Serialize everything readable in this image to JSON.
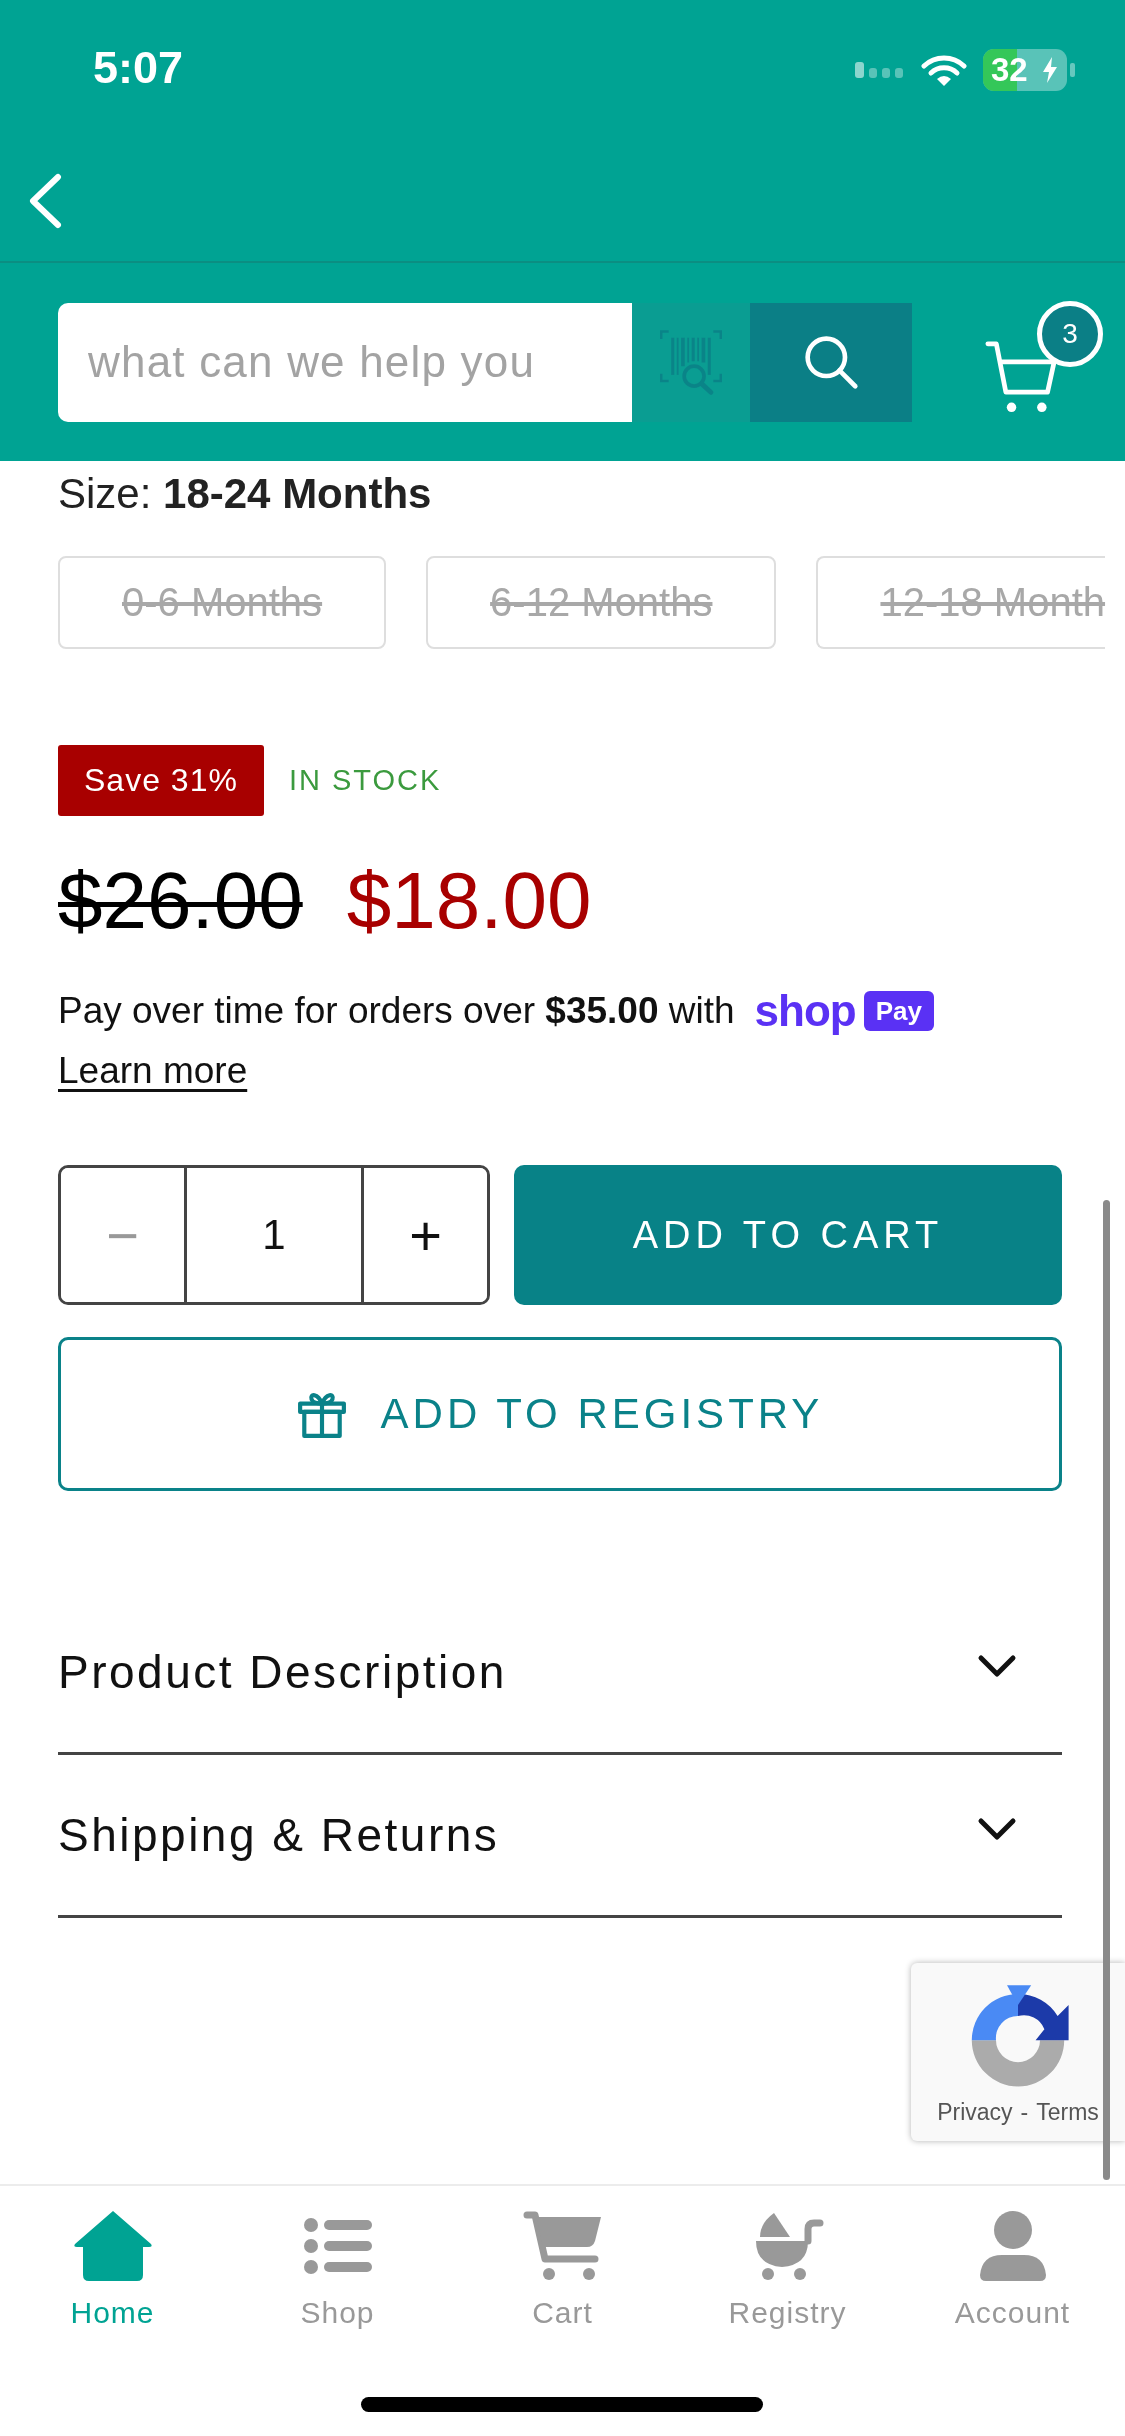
{
  "status_bar": {
    "time": "5:07",
    "battery": "32"
  },
  "search": {
    "placeholder": "what can we help you",
    "cart_count": "3"
  },
  "size": {
    "label": "Size:",
    "value": "18-24 Months",
    "options": [
      {
        "label": "0-6 Months",
        "selected": false,
        "available": false
      },
      {
        "label": "6-12 Months",
        "selected": false,
        "available": false
      },
      {
        "label": "12-18 Month",
        "selected": false,
        "available": false
      }
    ]
  },
  "badges": {
    "save": "Save 31%",
    "stock": "IN STOCK"
  },
  "price": {
    "compare_at": "$26.00",
    "current": "$18.00"
  },
  "installments": {
    "text": "Pay over time for orders over **$35.00** with",
    "brand": "shop",
    "brand_badge": "Pay",
    "link": "Learn more"
  },
  "quantity": {
    "decrease": {
      "label": "−",
      "disabled": true
    },
    "value": "1",
    "increase": {
      "label": "+",
      "disabled": false
    }
  },
  "add_to_cart": "ADD TO CART",
  "add_to_registry": "ADD TO REGISTRY",
  "accordions": [
    {
      "title": "Product Description",
      "expanded": false
    },
    {
      "title": "Shipping & Returns",
      "expanded": false
    }
  ],
  "recaptcha": {
    "privacy": "Privacy",
    "separator": "-",
    "terms": "Terms"
  },
  "tab_bar": [
    {
      "kind": "home",
      "label": "Home",
      "selected": true
    },
    {
      "kind": "shop",
      "label": "Shop",
      "selected": false
    },
    {
      "kind": "cart",
      "label": "Cart",
      "selected": false
    },
    {
      "kind": "registry",
      "label": "Registry",
      "selected": false
    },
    {
      "kind": "account",
      "label": "Account",
      "selected": false
    }
  ]
}
